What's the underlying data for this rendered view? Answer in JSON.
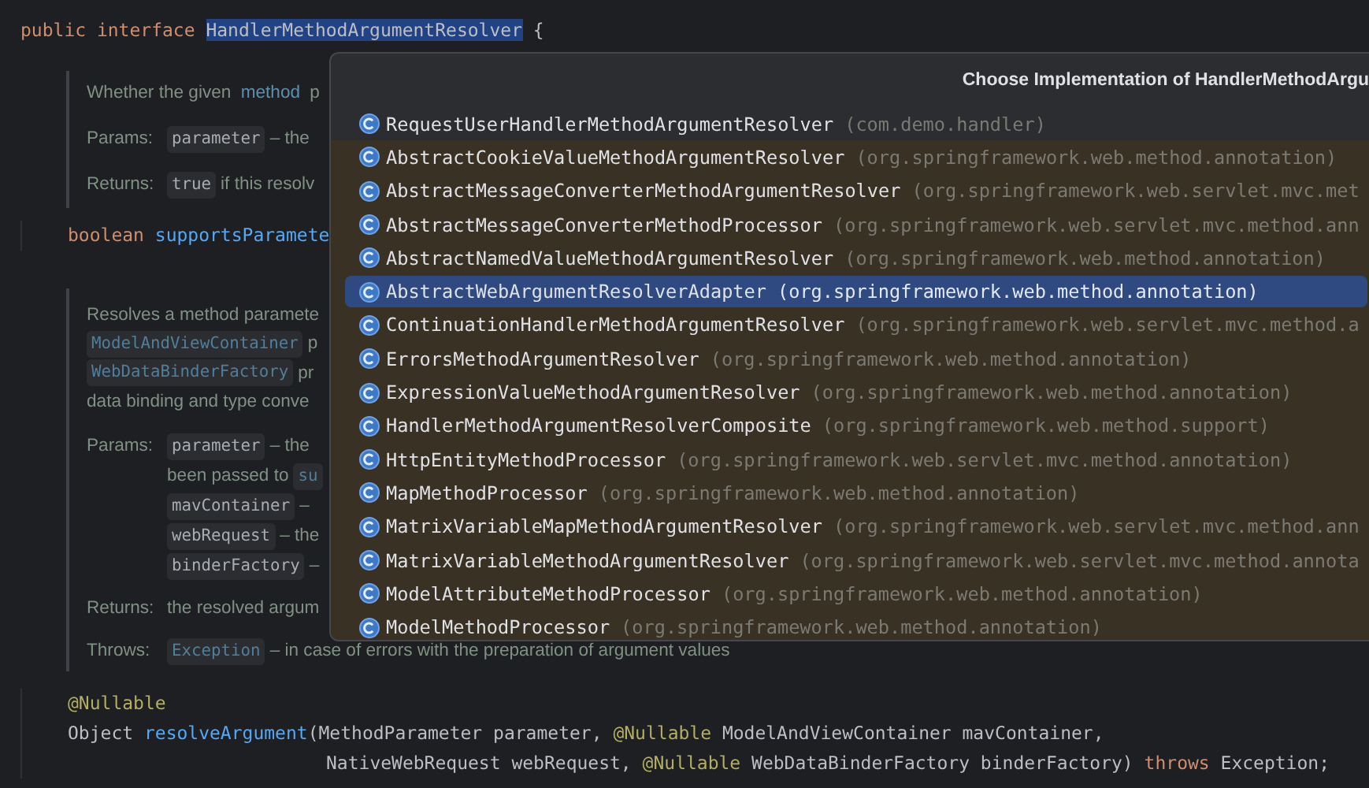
{
  "editor": {
    "blocks": [
      {
        "kind": "declaration",
        "tokens": [
          {
            "text": "public interface ",
            "kind": "keyword"
          },
          {
            "text": "HandlerMethodArgumentResolver",
            "kind": "highlight"
          },
          {
            "text": " {",
            "kind": "plain"
          }
        ]
      },
      {
        "kind": "doc",
        "summary": [
          [
            {
              "text": "Whether the given ",
              "kind": "doc"
            },
            {
              "text": "method",
              "kind": "link"
            },
            {
              "text": " p",
              "kind": "doc"
            }
          ]
        ],
        "sections": [
          {
            "label": "Params:",
            "lines": [
              [
                {
                  "text": "parameter",
                  "kind": "chip"
                },
                {
                  "text": "– the",
                  "kind": "doc"
                }
              ]
            ]
          },
          {
            "label": "Returns:",
            "lines": [
              [
                {
                  "text": "true",
                  "kind": "chip"
                },
                {
                  "text": "if this resolv",
                  "kind": "doc"
                }
              ]
            ]
          }
        ]
      },
      {
        "kind": "member",
        "tokens": [
          {
            "text": "boolean ",
            "kind": "keyword"
          },
          {
            "text": "supportsParamete",
            "kind": "method"
          }
        ]
      },
      {
        "kind": "doc",
        "summary": [
          [
            {
              "text": "Resolves a method paramete",
              "kind": "doc"
            }
          ],
          [
            {
              "text": "ModelAndViewContainer",
              "kind": "link_chip"
            },
            {
              "text": "p",
              "kind": "doc"
            }
          ],
          [
            {
              "text": "WebDataBinderFactory",
              "kind": "link_chip"
            },
            {
              "text": "pr",
              "kind": "doc"
            }
          ],
          [
            {
              "text": "data binding and type conve",
              "kind": "doc"
            }
          ]
        ],
        "sections": [
          {
            "label": "Params:",
            "lines": [
              [
                {
                  "text": "parameter",
                  "kind": "chip"
                },
                {
                  "text": "– the",
                  "kind": "doc"
                }
              ],
              [
                {
                  "text": "been passed to",
                  "kind": "doc"
                },
                {
                  "text": "su",
                  "kind": "link_chip"
                }
              ],
              [
                {
                  "text": "mavContainer",
                  "kind": "chip"
                },
                {
                  "text": "–",
                  "kind": "doc"
                }
              ],
              [
                {
                  "text": "webRequest",
                  "kind": "chip"
                },
                {
                  "text": "– the",
                  "kind": "doc"
                }
              ],
              [
                {
                  "text": "binderFactory",
                  "kind": "chip"
                },
                {
                  "text": "–",
                  "kind": "doc"
                }
              ]
            ]
          },
          {
            "label": "Returns:",
            "lines": [
              [
                {
                  "text": "the resolved argum",
                  "kind": "doc"
                }
              ]
            ]
          },
          {
            "label": "Throws:",
            "lines": [
              [
                {
                  "text": "Exception",
                  "kind": "link_chip"
                },
                {
                  "text": "– in case of errors with the preparation of argument values",
                  "kind": "doc"
                }
              ]
            ]
          }
        ]
      },
      {
        "kind": "member",
        "tokens": [
          {
            "text": "@Nullable",
            "kind": "annotation"
          }
        ]
      },
      {
        "kind": "member",
        "tokens": [
          {
            "text": "Object ",
            "kind": "plain"
          },
          {
            "text": "resolveArgument",
            "kind": "method"
          },
          {
            "text": "(MethodParameter parameter, ",
            "kind": "plain"
          },
          {
            "text": "@Nullable",
            "kind": "annotation"
          },
          {
            "text": " ModelAndViewContainer mavContainer,",
            "kind": "plain"
          }
        ]
      },
      {
        "kind": "continuation",
        "tokens": [
          {
            "text": "NativeWebRequest webRequest, ",
            "kind": "plain"
          },
          {
            "text": "@Nullable",
            "kind": "annotation"
          },
          {
            "text": " WebDataBinderFactory binderFactory) ",
            "kind": "plain"
          },
          {
            "text": "throws",
            "kind": "keyword"
          },
          {
            "text": " Exception;",
            "kind": "plain"
          }
        ]
      }
    ]
  },
  "popup": {
    "title": "Choose Implementation of HandlerMethodArgu",
    "items": [
      {
        "name": "RequestUserHandlerMethodArgumentResolver",
        "package": "(com.demo.handler)",
        "kind": "project",
        "selected": false
      },
      {
        "name": "AbstractCookieValueMethodArgumentResolver",
        "package": "(org.springframework.web.method.annotation)",
        "kind": "library",
        "selected": false
      },
      {
        "name": "AbstractMessageConverterMethodArgumentResolver",
        "package": "(org.springframework.web.servlet.mvc.met",
        "kind": "library",
        "selected": false
      },
      {
        "name": "AbstractMessageConverterMethodProcessor",
        "package": "(org.springframework.web.servlet.mvc.method.ann",
        "kind": "library",
        "selected": false
      },
      {
        "name": "AbstractNamedValueMethodArgumentResolver",
        "package": "(org.springframework.web.method.annotation)",
        "kind": "library",
        "selected": false
      },
      {
        "name": "AbstractWebArgumentResolverAdapter",
        "package": "(org.springframework.web.method.annotation)",
        "kind": "library",
        "selected": true
      },
      {
        "name": "ContinuationHandlerMethodArgumentResolver",
        "package": "(org.springframework.web.servlet.mvc.method.a",
        "kind": "library",
        "selected": false
      },
      {
        "name": "ErrorsMethodArgumentResolver",
        "package": "(org.springframework.web.method.annotation)",
        "kind": "library",
        "selected": false
      },
      {
        "name": "ExpressionValueMethodArgumentResolver",
        "package": "(org.springframework.web.method.annotation)",
        "kind": "library",
        "selected": false
      },
      {
        "name": "HandlerMethodArgumentResolverComposite",
        "package": "(org.springframework.web.method.support)",
        "kind": "library",
        "selected": false
      },
      {
        "name": "HttpEntityMethodProcessor",
        "package": "(org.springframework.web.servlet.mvc.method.annotation)",
        "kind": "library",
        "selected": false
      },
      {
        "name": "MapMethodProcessor",
        "package": "(org.springframework.web.method.annotation)",
        "kind": "library",
        "selected": false
      },
      {
        "name": "MatrixVariableMapMethodArgumentResolver",
        "package": "(org.springframework.web.servlet.mvc.method.ann",
        "kind": "library",
        "selected": false
      },
      {
        "name": "MatrixVariableMethodArgumentResolver",
        "package": "(org.springframework.web.servlet.mvc.method.annota",
        "kind": "library",
        "selected": false
      },
      {
        "name": "ModelAttributeMethodProcessor",
        "package": "(org.springframework.web.method.annotation)",
        "kind": "library",
        "selected": false
      },
      {
        "name": "ModelMethodProcessor",
        "package": "(org.springframework.web.method.annotation)",
        "kind": "library",
        "selected": false
      }
    ]
  }
}
